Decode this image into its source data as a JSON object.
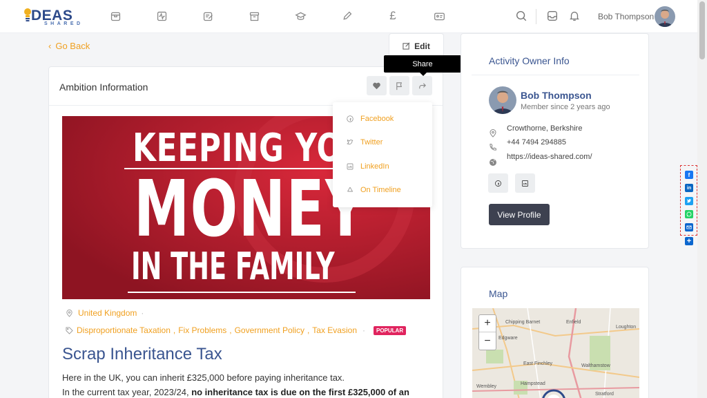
{
  "brand": {
    "name": "DEAS",
    "sub": "SHARED"
  },
  "topnav": {
    "icons": [
      "shop-icon",
      "activity-icon",
      "edit-note-icon",
      "archive-icon",
      "graduation-cap-icon",
      "pencil-icon",
      "pound-icon",
      "id-card-icon"
    ],
    "user_name": "Bob Thompson"
  },
  "page": {
    "back_label": "Go Back",
    "edit_label": "Edit",
    "card_title": "Ambition Information",
    "tooltip": "Share",
    "share_menu": [
      "Facebook",
      "Twitter",
      "LinkedIn",
      "On Timeline"
    ],
    "location": "United Kingdom",
    "tags": [
      "Disproportionate Taxation",
      "Fix Problems",
      "Government Policy",
      "Tax Evasion"
    ],
    "badge": "POPULAR",
    "title": "Scrap Inheritance Tax",
    "para1": "Here in the UK, you can inherit £325,000 before paying inheritance tax.",
    "para2_start": "In the current tax year, 2023/24, ",
    "para2_bold": "no inheritance tax is due on the first £325,000 of an",
    "hero": {
      "line1": "KEEPING YOU",
      "line2": "MONEY",
      "line3": "IN THE FAMILY"
    }
  },
  "owner": {
    "heading": "Activity Owner Info",
    "name": "Bob Thompson",
    "since": "Member since 2 years ago",
    "location": "Crowthorne, Berkshire",
    "phone": "+44 7494 294885",
    "website": "https://ideas-shared.com/",
    "view_profile": "View Profile"
  },
  "map": {
    "heading": "Map",
    "labels": [
      "Chipping Barnet",
      "Enfield",
      "Loughton",
      "Edgware",
      "East Finchley",
      "Walthamstow",
      "Wembley",
      "Hampstead",
      "Stratford"
    ]
  },
  "colors": {
    "accent": "#f0a020",
    "title": "#3a5590",
    "hero": "#b51c2c",
    "badge": "#e0245e"
  }
}
